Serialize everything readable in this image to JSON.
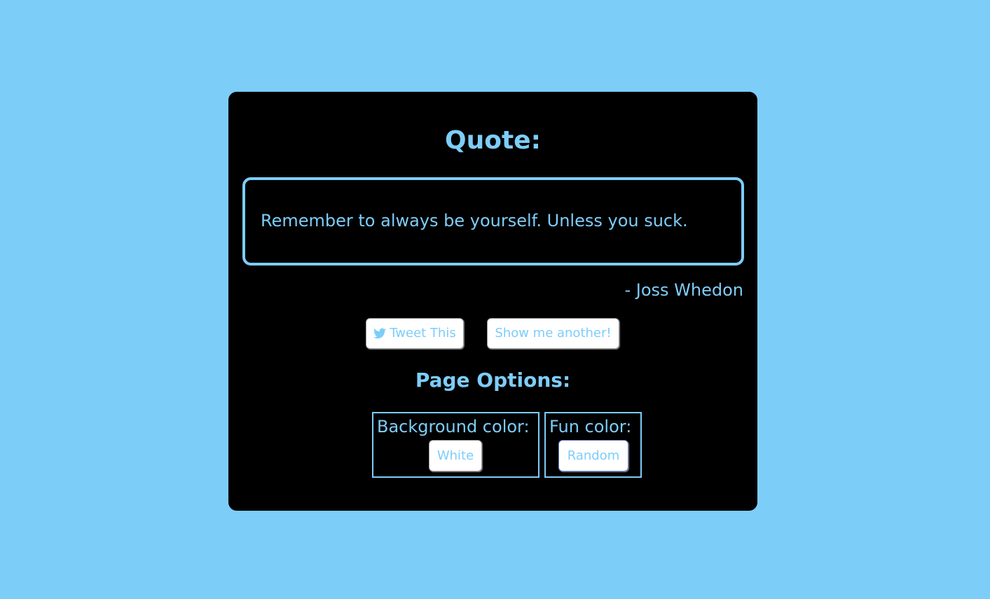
{
  "header": {
    "title": "Quote:"
  },
  "quote": {
    "text": "Remember to always be yourself. Unless you suck.",
    "author": "- Joss Whedon"
  },
  "actions": {
    "tweet_label": "Tweet This",
    "tweet_icon": "twitter-icon",
    "another_label": "Show me another!"
  },
  "options": {
    "title": "Page Options:",
    "background": {
      "label": "Background color:",
      "button": "White"
    },
    "fun": {
      "label": "Fun color:",
      "button": "Random"
    }
  },
  "colors": {
    "accent": "#7dcdf9",
    "card_background": "#000000",
    "button_background": "#ffffff"
  }
}
